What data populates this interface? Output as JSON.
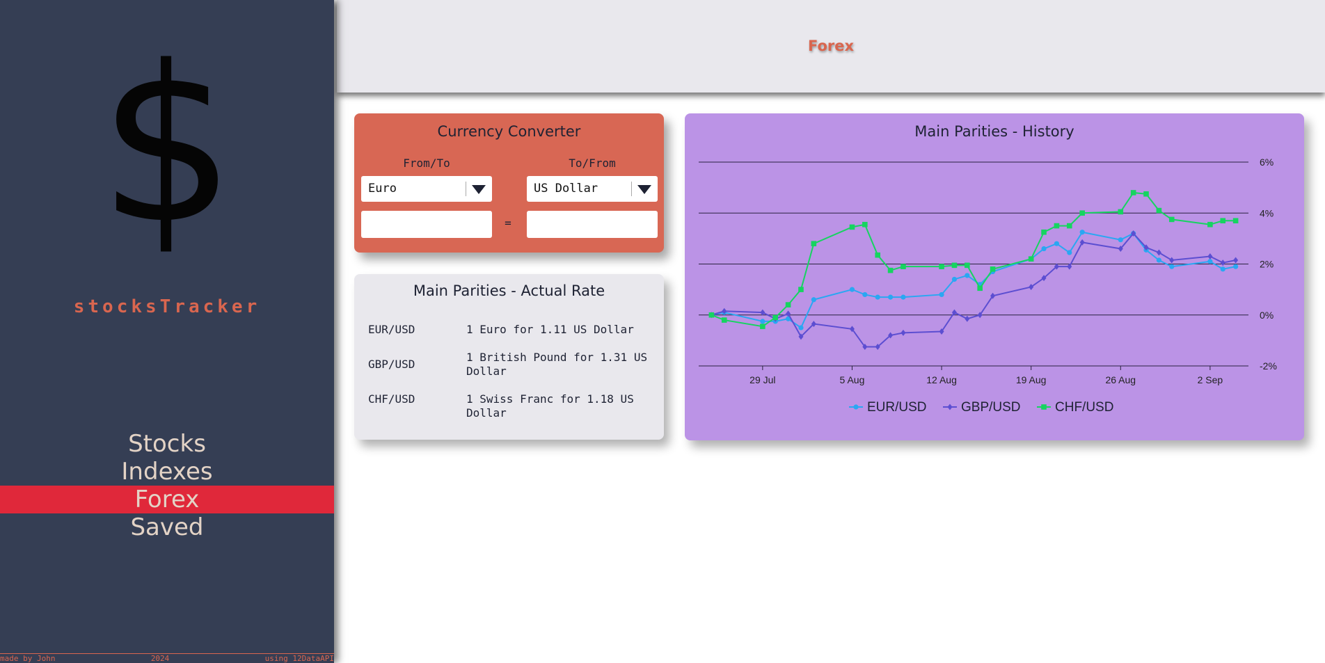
{
  "sidebar": {
    "logo_symbol": "$",
    "brand": "stocksTracker",
    "nav": [
      {
        "label": "Stocks",
        "active": false
      },
      {
        "label": "Indexes",
        "active": false
      },
      {
        "label": "Forex",
        "active": true
      },
      {
        "label": "Saved",
        "active": false
      }
    ],
    "footer": {
      "left": "made by John",
      "center": "2024",
      "right": "using 12DataAPI"
    }
  },
  "header": {
    "title": "Forex"
  },
  "converter": {
    "title": "Currency Converter",
    "from_label": "From/To",
    "to_label": "To/From",
    "from_currency": "Euro",
    "to_currency": "US Dollar",
    "from_amount": "",
    "to_amount": "",
    "equals": "="
  },
  "actual_rates": {
    "title": "Main Parities - Actual Rate",
    "rows": [
      {
        "pair": "EUR/USD",
        "text": "1 Euro for 1.11 US Dollar"
      },
      {
        "pair": "GBP/USD",
        "text": "1 British Pound for 1.31 US Dollar"
      },
      {
        "pair": "CHF/USD",
        "text": "1 Swiss Franc for 1.18 US Dollar"
      }
    ]
  },
  "history": {
    "title": "Main Parities - History"
  },
  "colors": {
    "sidebar_bg": "#353e54",
    "accent": "#d9664f",
    "active_nav": "#e0283a",
    "chart_bg": "#bb93e6",
    "eur": "#2aa7f2",
    "gbp": "#5c4ed1",
    "chf": "#16d460"
  },
  "chart_data": {
    "type": "line",
    "title": "Main Parities - History",
    "xlabel": "",
    "ylabel": "",
    "x_ticks": [
      "29 Jul",
      "5 Aug",
      "12 Aug",
      "19 Aug",
      "26 Aug",
      "2 Sep"
    ],
    "y_ticks": [
      "6%",
      "4%",
      "2%",
      "0%",
      "-2%"
    ],
    "ylim": [
      -2,
      6
    ],
    "grid": true,
    "legend": "bottom",
    "x": [
      "2024-07-25",
      "2024-07-26",
      "2024-07-29",
      "2024-07-30",
      "2024-07-31",
      "2024-08-01",
      "2024-08-02",
      "2024-08-05",
      "2024-08-06",
      "2024-08-07",
      "2024-08-08",
      "2024-08-09",
      "2024-08-12",
      "2024-08-13",
      "2024-08-14",
      "2024-08-15",
      "2024-08-16",
      "2024-08-19",
      "2024-08-20",
      "2024-08-21",
      "2024-08-22",
      "2024-08-23",
      "2024-08-26",
      "2024-08-27",
      "2024-08-28",
      "2024-08-29",
      "2024-08-30",
      "2024-09-02",
      "2024-09-03",
      "2024-09-04"
    ],
    "series": [
      {
        "name": "EUR/USD",
        "marker": "circle",
        "values": [
          0.0,
          0.1,
          -0.25,
          -0.25,
          -0.15,
          -0.5,
          0.6,
          1.0,
          0.8,
          0.7,
          0.7,
          0.7,
          0.8,
          1.4,
          1.55,
          1.2,
          1.7,
          2.2,
          2.6,
          2.8,
          2.45,
          3.25,
          2.95,
          3.2,
          2.55,
          2.15,
          1.9,
          2.1,
          1.8,
          1.9
        ]
      },
      {
        "name": "GBP/USD",
        "marker": "diamond",
        "values": [
          0.0,
          0.15,
          0.1,
          -0.15,
          0.05,
          -0.85,
          -0.35,
          -0.55,
          -1.25,
          -1.25,
          -0.8,
          -0.7,
          -0.65,
          0.1,
          -0.15,
          0.0,
          0.75,
          1.1,
          1.45,
          1.9,
          1.9,
          2.85,
          2.6,
          3.2,
          2.65,
          2.45,
          2.15,
          2.3,
          2.05,
          2.15
        ]
      },
      {
        "name": "CHF/USD",
        "marker": "square",
        "values": [
          0.0,
          -0.2,
          -0.45,
          -0.1,
          0.4,
          1.0,
          2.8,
          3.45,
          3.55,
          2.35,
          1.75,
          1.9,
          1.9,
          1.95,
          1.95,
          1.05,
          1.8,
          2.2,
          3.25,
          3.5,
          3.5,
          4.0,
          4.05,
          4.8,
          4.75,
          4.1,
          3.75,
          3.55,
          3.7,
          3.7
        ]
      }
    ]
  }
}
